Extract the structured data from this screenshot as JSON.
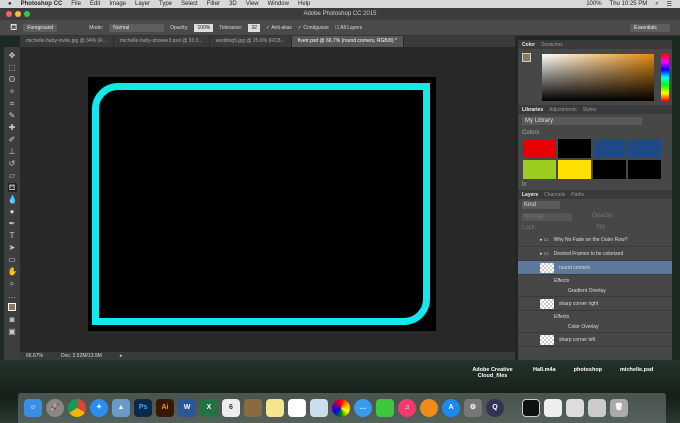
{
  "menubar": {
    "app": "Photoshop CC",
    "items": [
      "File",
      "Edit",
      "Image",
      "Layer",
      "Type",
      "Select",
      "Filter",
      "3D",
      "View",
      "Window",
      "Help"
    ],
    "battery": "100%",
    "clock": "Thu 10:25 PM"
  },
  "window": {
    "title": "Adobe Photoshop CC 2015"
  },
  "options": {
    "fill_source": "Foreground",
    "mode_label": "Mode:",
    "mode": "Normal",
    "opacity_label": "Opacity:",
    "opacity": "100%",
    "tolerance_label": "Tolerance:",
    "tolerance": "32",
    "antialias": "Anti-alias",
    "contiguous": "Contiguous",
    "all_layers": "All Layers",
    "workspace": "Essentials"
  },
  "tabs": [
    "michelle-baby-invite.jpg @ 34% (R...",
    "michelle-baby-shower2.psd @ 33.3...",
    "wedding5.jpg @ 25.6% (RCB...",
    "fiverr.psd @ 66.7% (round corners, RGB/8) *"
  ],
  "status": {
    "zoom": "66.67%",
    "doc": "Doc: 2.52M/13.9M"
  },
  "color_panel": {
    "tabs": [
      "Color",
      "Swatches"
    ]
  },
  "libraries": {
    "tabs": [
      "Libraries",
      "Adjustments",
      "Styles"
    ],
    "library": "My Library",
    "colors_label": "Colors",
    "swatches": [
      "#e80000",
      "#000000",
      "#1f4a85",
      "#1f4a85",
      "#9acd20",
      "#ffe000",
      "#000000",
      "#000000"
    ]
  },
  "layers": {
    "tabs": [
      "Layers",
      "Channels",
      "Paths"
    ],
    "filter": "Kind",
    "blend": "Normal",
    "opacity_label": "Opacity:",
    "lock_label": "Lock:",
    "fill_label": "Fill:",
    "rows": [
      {
        "name": "Why No Fade on the Outer Row?",
        "type": "group"
      },
      {
        "name": "Desired Frames to be colorized",
        "type": "group"
      },
      {
        "name": "round corners",
        "type": "layer",
        "selected": true
      },
      {
        "name": "Effects",
        "type": "effects"
      },
      {
        "name": "Gradient Overlay",
        "type": "effect"
      },
      {
        "name": "sharp corner right",
        "type": "layer"
      },
      {
        "name": "Effects",
        "type": "effects"
      },
      {
        "name": "Color Overlay",
        "type": "effect"
      },
      {
        "name": "sharp corner left",
        "type": "layer"
      }
    ]
  },
  "desktop": {
    "files": [
      "Adobe Creative Cloud_files",
      "Hall.m4a",
      "photoshop",
      "michelle.psd"
    ]
  },
  "dock": [
    {
      "label": "Ps",
      "color": "#0a2a4a"
    },
    {
      "label": "Ai",
      "color": "#3a1800"
    },
    {
      "label": "W",
      "color": "#2b579a"
    },
    {
      "label": "X",
      "color": "#217346"
    },
    {
      "label": "6",
      "color": "#eee"
    }
  ]
}
